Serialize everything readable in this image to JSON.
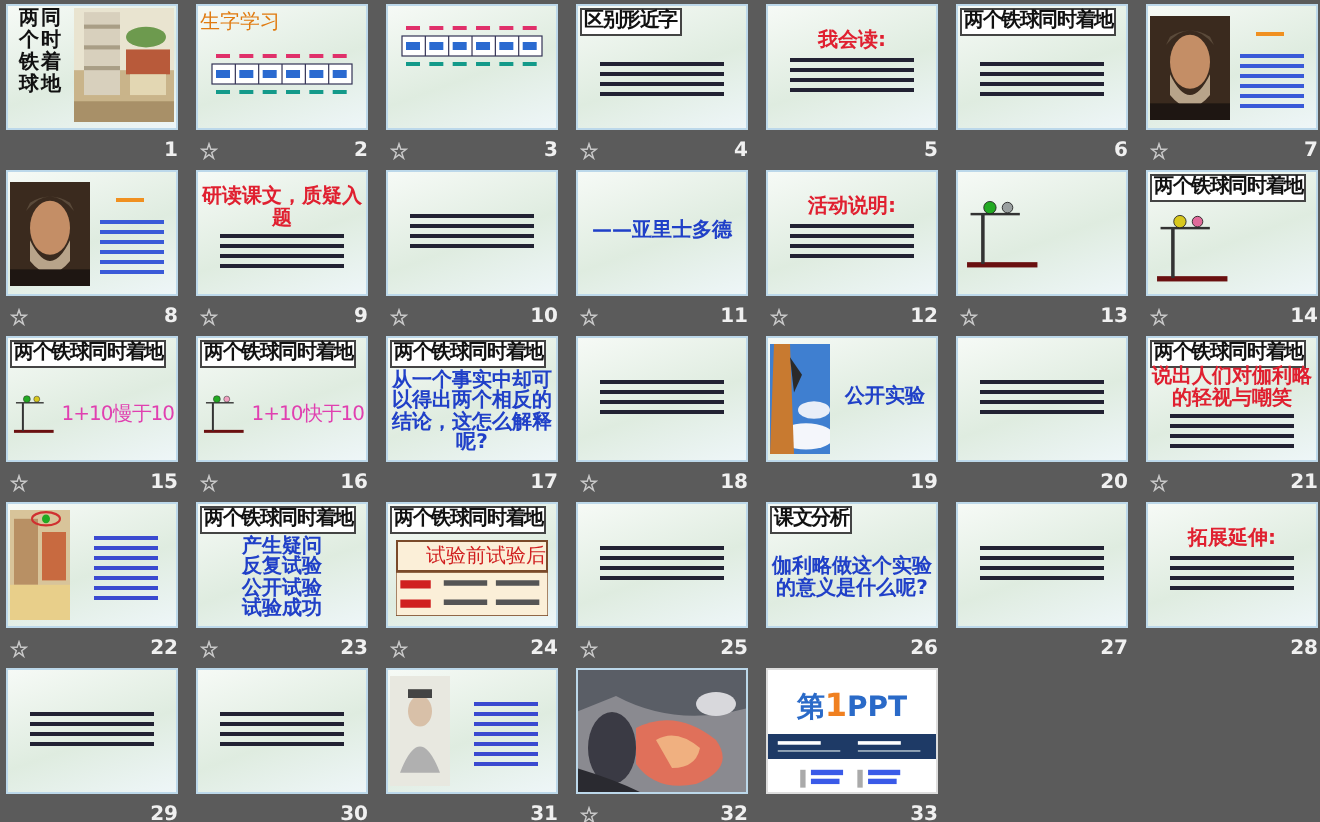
{
  "slides": [
    {
      "number": "1",
      "animated": false,
      "kind": "title",
      "columns": [
        "两个铁球",
        "同时着地"
      ]
    },
    {
      "number": "2",
      "animated": true,
      "kind": "pinyin",
      "heading": "生字学习"
    },
    {
      "number": "3",
      "animated": true,
      "kind": "pinyin"
    },
    {
      "number": "4",
      "animated": true,
      "kind": "text",
      "header": "区别形近字"
    },
    {
      "number": "5",
      "animated": false,
      "kind": "text",
      "lines": [
        {
          "text": "我会读:",
          "accent": true
        }
      ]
    },
    {
      "number": "6",
      "animated": false,
      "kind": "text",
      "header": "两个铁球同时着地"
    },
    {
      "number": "7",
      "animated": true,
      "kind": "portrait"
    },
    {
      "number": "8",
      "animated": true,
      "kind": "portrait"
    },
    {
      "number": "9",
      "animated": true,
      "kind": "text",
      "lines": [
        {
          "text": "研读课文，质疑入题",
          "accent": true
        }
      ]
    },
    {
      "number": "10",
      "animated": true,
      "kind": "text"
    },
    {
      "number": "11",
      "animated": true,
      "kind": "text",
      "lines": [
        {
          "text": "——亚里士多德",
          "accent": false
        }
      ]
    },
    {
      "number": "12",
      "animated": true,
      "kind": "text",
      "lines": [
        {
          "text": "活动说明:",
          "accent": true
        }
      ]
    },
    {
      "number": "13",
      "animated": true,
      "kind": "diagram",
      "balls": [
        {
          "color": "#22aa22"
        },
        {
          "color": "#9aa0a0"
        }
      ]
    },
    {
      "number": "14",
      "animated": true,
      "kind": "diagram",
      "header": "两个铁球同时着地",
      "balls": [
        {
          "color": "#d8c81c"
        },
        {
          "color": "#e06a9a"
        }
      ]
    },
    {
      "number": "15",
      "animated": true,
      "kind": "diagram",
      "header": "两个铁球同时着地",
      "label": "1+10慢于10",
      "balls": [
        {
          "color": "#22aa22"
        },
        {
          "color": "#d8c81c"
        }
      ]
    },
    {
      "number": "16",
      "animated": true,
      "kind": "diagram",
      "header": "两个铁球同时着地",
      "label": "1+10快于10",
      "balls": [
        {
          "color": "#22aa22"
        },
        {
          "color": "#f0a0c0"
        }
      ]
    },
    {
      "number": "17",
      "animated": false,
      "kind": "text",
      "header": "两个铁球同时着地",
      "lines": [
        {
          "text": "从一个事实中却可以得出两个相反的结论，这怎么解释呢?",
          "accent": false
        }
      ]
    },
    {
      "number": "18",
      "animated": true,
      "kind": "text"
    },
    {
      "number": "19",
      "animated": false,
      "kind": "picture_text",
      "lines": [
        {
          "text": "公开实验",
          "accent": false
        }
      ]
    },
    {
      "number": "20",
      "animated": false,
      "kind": "text"
    },
    {
      "number": "21",
      "animated": true,
      "kind": "text",
      "header": "两个铁球同时着地",
      "lines": [
        {
          "text": "说出人们对伽利略的轻视与嘲笑",
          "accent": true
        }
      ]
    },
    {
      "number": "22",
      "animated": true,
      "kind": "picture_text"
    },
    {
      "number": "23",
      "animated": true,
      "kind": "text",
      "header": "两个铁球同时着地",
      "lines": [
        {
          "text": "产生疑问",
          "accent": false
        },
        {
          "text": "反复试验",
          "accent": false
        },
        {
          "text": "公开试验",
          "accent": false
        },
        {
          "text": "试验成功",
          "accent": false
        }
      ]
    },
    {
      "number": "24",
      "animated": true,
      "kind": "table",
      "header": "两个铁球同时着地",
      "columns": [
        "试验前",
        "试验后"
      ]
    },
    {
      "number": "25",
      "animated": true,
      "kind": "text"
    },
    {
      "number": "26",
      "animated": false,
      "kind": "text",
      "header": "课文分析",
      "lines": [
        {
          "text": "伽利略做这个实验的意义是什么呢?",
          "accent": false
        }
      ]
    },
    {
      "number": "27",
      "animated": false,
      "kind": "text"
    },
    {
      "number": "28",
      "animated": false,
      "kind": "text",
      "lines": [
        {
          "text": "拓展延伸:",
          "accent": true
        }
      ]
    },
    {
      "number": "29",
      "animated": false,
      "kind": "text"
    },
    {
      "number": "30",
      "animated": false,
      "kind": "text"
    },
    {
      "number": "31",
      "animated": false,
      "kind": "picture_text"
    },
    {
      "number": "32",
      "animated": true,
      "kind": "picture"
    },
    {
      "number": "33",
      "animated": false,
      "kind": "logo",
      "columns": [
        "第",
        "1",
        "PPT"
      ]
    }
  ]
}
